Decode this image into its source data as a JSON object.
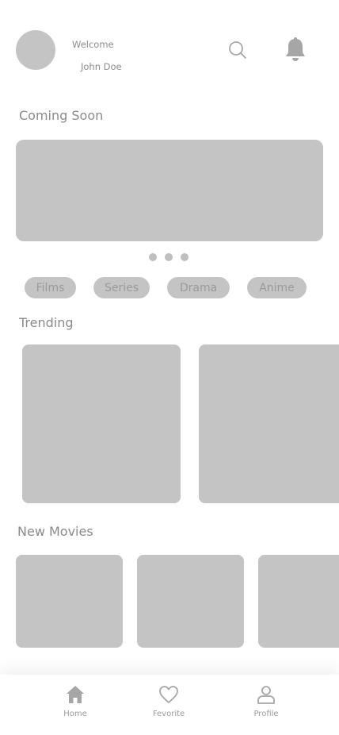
{
  "header": {
    "welcome": "Welcome",
    "username": "John Doe",
    "icons": [
      "search-icon",
      "bell-icon"
    ]
  },
  "sections": {
    "coming_soon": "Coming Soon",
    "trending": "Trending",
    "new_movies": "New Movies"
  },
  "categories": [
    "Films",
    "Series",
    "Drama",
    "Anime"
  ],
  "bottom_nav": [
    {
      "label": "Home",
      "icon": "home-icon"
    },
    {
      "label": "Fevorite",
      "icon": "heart-icon"
    },
    {
      "label": "Profile",
      "icon": "user-icon"
    }
  ],
  "colors": {
    "placeholder": "#c4c4c4",
    "text": "#8a8a8a",
    "background": "#ffffff"
  }
}
